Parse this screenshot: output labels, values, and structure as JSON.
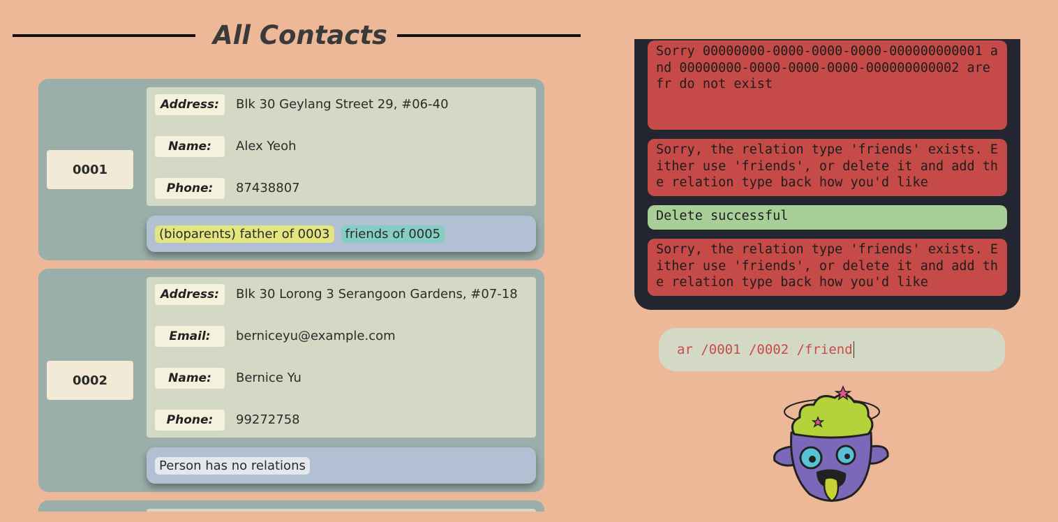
{
  "header": {
    "title": "All Contacts"
  },
  "contacts": [
    {
      "id": "0001",
      "fields": [
        {
          "label": "Address:",
          "value": "Blk 30 Geylang Street 29, #06-40"
        },
        {
          "label": "Name:",
          "value": "Alex Yeoh"
        },
        {
          "label": "Phone:",
          "value": "87438807"
        }
      ],
      "relations": [
        {
          "text": "(bioparents) father of 0003",
          "color": "#e3e57e"
        },
        {
          "text": "friends of 0005",
          "color": "#86cdc4"
        }
      ]
    },
    {
      "id": "0002",
      "fields": [
        {
          "label": "Address:",
          "value": "Blk 30 Lorong 3 Serangoon Gardens, #07-18"
        },
        {
          "label": "Email:",
          "value": "berniceyu@example.com"
        },
        {
          "label": "Name:",
          "value": "Bernice Yu"
        },
        {
          "label": "Phone:",
          "value": "99272758"
        }
      ],
      "relations": [
        {
          "text": "Person has no relations",
          "color": "#e4e7ee"
        }
      ]
    }
  ],
  "feedback": [
    {
      "type": "error",
      "text": "Sorry 00000000-0000-0000-0000-000000000001 and 00000000-0000-0000-0000-000000000002 are fr do not exist"
    },
    {
      "type": "error",
      "text": "Sorry, the relation type 'friends' exists. Either use 'friends', or delete it and add the relation type back how you'd like"
    },
    {
      "type": "success",
      "text": "Delete successful"
    },
    {
      "type": "error",
      "text": "Sorry, the relation type 'friends' exists. Either use 'friends', or delete it and add the relation type back how you'd like"
    }
  ],
  "command": {
    "value": "ar /0001 /0002 /friend"
  },
  "colors": {
    "background": "#edb897",
    "card": "#9aaeaa",
    "panel": "#232630",
    "error": "#c64b48",
    "success": "#a8cf98"
  },
  "mascot": {
    "icon": "zombie-mascot-icon"
  }
}
